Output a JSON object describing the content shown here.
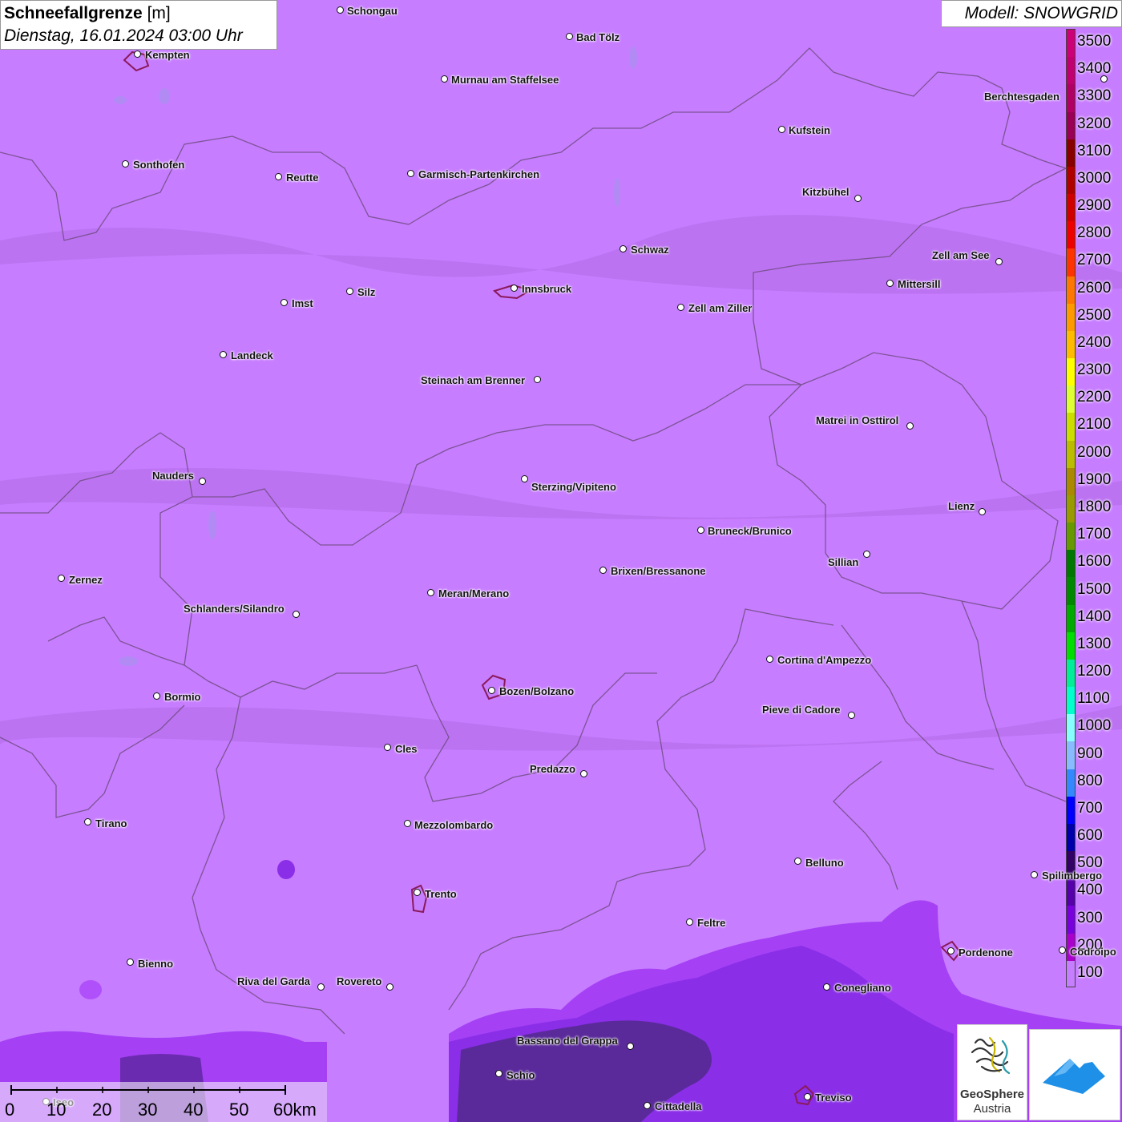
{
  "title": {
    "parameter": "Schneefallgrenze",
    "unit": "[m]",
    "datetime": "Dienstag, 16.01.2024 03:00 Uhr"
  },
  "model_label": "Modell: SNOWGRID",
  "legend": {
    "levels": [
      {
        "value": "3500",
        "color": "#cc0077"
      },
      {
        "value": "3400",
        "color": "#c00070"
      },
      {
        "value": "3300",
        "color": "#b00066"
      },
      {
        "value": "3200",
        "color": "#990055"
      },
      {
        "value": "3100",
        "color": "#880000"
      },
      {
        "value": "3000",
        "color": "#b00000"
      },
      {
        "value": "2900",
        "color": "#d00000"
      },
      {
        "value": "2800",
        "color": "#ee0000"
      },
      {
        "value": "2700",
        "color": "#ff3300"
      },
      {
        "value": "2600",
        "color": "#ff7700"
      },
      {
        "value": "2500",
        "color": "#ff9900"
      },
      {
        "value": "2400",
        "color": "#ffbb00"
      },
      {
        "value": "2300",
        "color": "#ffff00"
      },
      {
        "value": "2200",
        "color": "#ddff33"
      },
      {
        "value": "2100",
        "color": "#ccdd00"
      },
      {
        "value": "2000",
        "color": "#bbbb00"
      },
      {
        "value": "1900",
        "color": "#aa8800"
      },
      {
        "value": "1800",
        "color": "#999900"
      },
      {
        "value": "1700",
        "color": "#669900"
      },
      {
        "value": "1600",
        "color": "#007700"
      },
      {
        "value": "1500",
        "color": "#008800"
      },
      {
        "value": "1400",
        "color": "#00aa00"
      },
      {
        "value": "1300",
        "color": "#00dd00"
      },
      {
        "value": "1200",
        "color": "#00ee99"
      },
      {
        "value": "1100",
        "color": "#00ffcc"
      },
      {
        "value": "1000",
        "color": "#88ffff"
      },
      {
        "value": "900",
        "color": "#88bbff"
      },
      {
        "value": "800",
        "color": "#3388ff"
      },
      {
        "value": "700",
        "color": "#0000ff"
      },
      {
        "value": "600",
        "color": "#0000aa"
      },
      {
        "value": "500",
        "color": "#330066"
      },
      {
        "value": "400",
        "color": "#5500aa"
      },
      {
        "value": "300",
        "color": "#7700dd"
      },
      {
        "value": "200",
        "color": "#aa00cc"
      },
      {
        "value": "100",
        "color": "#c77dff"
      }
    ]
  },
  "cities": [
    {
      "name": "Schongau",
      "dot": [
        425,
        13
      ],
      "label": [
        433,
        7
      ],
      "anchor": "left"
    },
    {
      "name": "Bad Tölz",
      "dot": [
        711,
        46
      ],
      "label": [
        719,
        40
      ],
      "anchor": "left"
    },
    {
      "name": "Kempten",
      "dot": [
        172,
        68
      ],
      "label": [
        181,
        62
      ],
      "anchor": "left"
    },
    {
      "name": "Murnau am Staffelsee",
      "dot": [
        555,
        99
      ],
      "label": [
        563,
        93
      ],
      "anchor": "left"
    },
    {
      "name": "Berchtesgaden",
      "dot": [
        1378,
        99
      ],
      "label": [
        1228,
        114
      ],
      "anchor": "left"
    },
    {
      "name": "Kufstein",
      "dot": [
        976,
        162
      ],
      "label": [
        984,
        156
      ],
      "anchor": "left"
    },
    {
      "name": "Sonthofen",
      "dot": [
        157,
        205
      ],
      "label": [
        166,
        199
      ],
      "anchor": "left"
    },
    {
      "name": "Reutte",
      "dot": [
        348,
        221
      ],
      "label": [
        357,
        215
      ],
      "anchor": "left"
    },
    {
      "name": "Garmisch-Partenkirchen",
      "dot": [
        513,
        217
      ],
      "label": [
        522,
        211
      ],
      "anchor": "left"
    },
    {
      "name": "Kitzbühel",
      "dot": [
        1071,
        248
      ],
      "label": [
        1001,
        233
      ],
      "anchor": "left"
    },
    {
      "name": "Schwaz",
      "dot": [
        778,
        311
      ],
      "label": [
        787,
        305
      ],
      "anchor": "left"
    },
    {
      "name": "Zell am See",
      "dot": [
        1247,
        327
      ],
      "label": [
        1163,
        312
      ],
      "anchor": "left"
    },
    {
      "name": "Mittersill",
      "dot": [
        1111,
        354
      ],
      "label": [
        1120,
        348
      ],
      "anchor": "left"
    },
    {
      "name": "Innsbruck",
      "dot": [
        642,
        360
      ],
      "label": [
        651,
        354
      ],
      "anchor": "left"
    },
    {
      "name": "Silz",
      "dot": [
        437,
        364
      ],
      "label": [
        446,
        358
      ],
      "anchor": "left"
    },
    {
      "name": "Imst",
      "dot": [
        355,
        378
      ],
      "label": [
        364,
        372
      ],
      "anchor": "left"
    },
    {
      "name": "Zell am Ziller",
      "dot": [
        850,
        384
      ],
      "label": [
        859,
        378
      ],
      "anchor": "left"
    },
    {
      "name": "Landeck",
      "dot": [
        279,
        443
      ],
      "label": [
        288,
        437
      ],
      "anchor": "left"
    },
    {
      "name": "Steinach am Brenner",
      "dot": [
        671,
        474
      ],
      "label": [
        525,
        468
      ],
      "anchor": "left"
    },
    {
      "name": "Matrei in Osttirol",
      "dot": [
        1136,
        532
      ],
      "label": [
        1018,
        518
      ],
      "anchor": "left"
    },
    {
      "name": "Nauders",
      "dot": [
        253,
        601
      ],
      "label": [
        190,
        587
      ],
      "anchor": "left"
    },
    {
      "name": "Sterzing/Vipiteno",
      "dot": [
        655,
        598
      ],
      "label": [
        663,
        601
      ],
      "anchor": "left"
    },
    {
      "name": "Lienz",
      "dot": [
        1226,
        639
      ],
      "label": [
        1183,
        625
      ],
      "anchor": "left"
    },
    {
      "name": "Bruneck/Brunico",
      "dot": [
        875,
        662
      ],
      "label": [
        883,
        656
      ],
      "anchor": "left"
    },
    {
      "name": "Sillian",
      "dot": [
        1082,
        692
      ],
      "label": [
        1033,
        695
      ],
      "anchor": "left"
    },
    {
      "name": "Brixen/Bressanone",
      "dot": [
        753,
        712
      ],
      "label": [
        762,
        706
      ],
      "anchor": "left"
    },
    {
      "name": "Zernez",
      "dot": [
        77,
        722
      ],
      "label": [
        86,
        717
      ],
      "anchor": "left"
    },
    {
      "name": "Meran/Merano",
      "dot": [
        538,
        740
      ],
      "label": [
        547,
        734
      ],
      "anchor": "left"
    },
    {
      "name": "Schlanders/Silandro",
      "dot": [
        370,
        767
      ],
      "label": [
        229,
        753
      ],
      "anchor": "left"
    },
    {
      "name": "Cortina d'Ampezzo",
      "dot": [
        961,
        823
      ],
      "label": [
        970,
        817
      ],
      "anchor": "left"
    },
    {
      "name": "Bozen/Bolzano",
      "dot": [
        614,
        862
      ],
      "label": [
        623,
        856
      ],
      "anchor": "left"
    },
    {
      "name": "Bormio",
      "dot": [
        196,
        869
      ],
      "label": [
        205,
        863
      ],
      "anchor": "left"
    },
    {
      "name": "Pieve di Cadore",
      "dot": [
        1063,
        893
      ],
      "label": [
        951,
        879
      ],
      "anchor": "left"
    },
    {
      "name": "Cles",
      "dot": [
        484,
        933
      ],
      "label": [
        493,
        928
      ],
      "anchor": "left"
    },
    {
      "name": "Predazzo",
      "dot": [
        729,
        966
      ],
      "label": [
        661,
        953
      ],
      "anchor": "left"
    },
    {
      "name": "Tirano",
      "dot": [
        110,
        1026
      ],
      "label": [
        119,
        1021
      ],
      "anchor": "left"
    },
    {
      "name": "Mezzolombardo",
      "dot": [
        509,
        1028
      ],
      "label": [
        517,
        1023
      ],
      "anchor": "left"
    },
    {
      "name": "Belluno",
      "dot": [
        996,
        1075
      ],
      "label": [
        1005,
        1070
      ],
      "anchor": "left"
    },
    {
      "name": "Spilimbergo",
      "dot": [
        1291,
        1092
      ],
      "label": [
        1300,
        1086
      ],
      "anchor": "left"
    },
    {
      "name": "Trento",
      "dot": [
        521,
        1114
      ],
      "label": [
        530,
        1109
      ],
      "anchor": "left"
    },
    {
      "name": "Feltre",
      "dot": [
        861,
        1151
      ],
      "label": [
        870,
        1145
      ],
      "anchor": "left"
    },
    {
      "name": "Pordenone",
      "dot": [
        1187,
        1187
      ],
      "label": [
        1196,
        1182
      ],
      "anchor": "left"
    },
    {
      "name": "Codroipo",
      "dot": [
        1326,
        1186
      ],
      "label": [
        1335,
        1181
      ],
      "anchor": "left"
    },
    {
      "name": "Bienno",
      "dot": [
        163,
        1201
      ],
      "label": [
        172,
        1196
      ],
      "anchor": "left"
    },
    {
      "name": "Riva del Garda",
      "dot": [
        401,
        1232
      ],
      "label": [
        296,
        1218
      ],
      "anchor": "left"
    },
    {
      "name": "Rovereto",
      "dot": [
        487,
        1232
      ],
      "label": [
        420,
        1218
      ],
      "anchor": "left"
    },
    {
      "name": "Conegliano",
      "dot": [
        1032,
        1232
      ],
      "label": [
        1041,
        1226
      ],
      "anchor": "left"
    },
    {
      "name": "Bassano del Grappa",
      "dot": [
        787,
        1306
      ],
      "label": [
        645,
        1292
      ],
      "anchor": "left"
    },
    {
      "name": "Schio",
      "dot": [
        623,
        1340
      ],
      "label": [
        632,
        1335
      ],
      "anchor": "left"
    },
    {
      "name": "Treviso",
      "dot": [
        1008,
        1369
      ],
      "label": [
        1017,
        1363
      ],
      "anchor": "left"
    },
    {
      "name": "Cittadella",
      "dot": [
        808,
        1380
      ],
      "label": [
        817,
        1374
      ],
      "anchor": "left"
    },
    {
      "name": "Iseo",
      "dot": [
        58,
        1375
      ],
      "label": [
        66,
        1369
      ],
      "anchor": "left"
    }
  ],
  "scalebar": {
    "labels": [
      "0",
      "10",
      "20",
      "30",
      "40",
      "50",
      "60km"
    ]
  },
  "logo": {
    "line1": "GeoSphere",
    "line2": "Austria"
  }
}
